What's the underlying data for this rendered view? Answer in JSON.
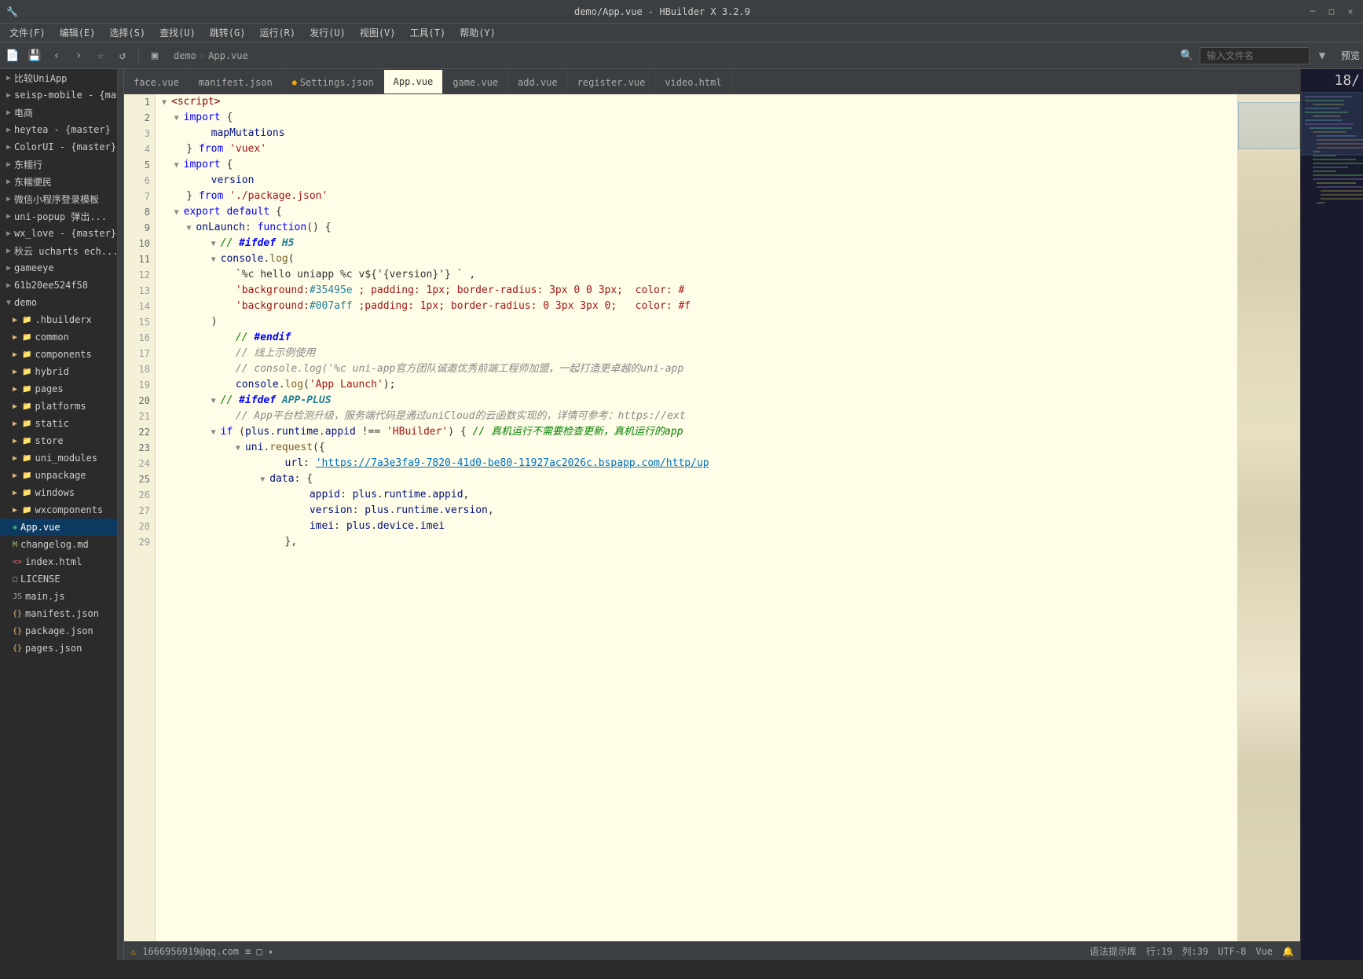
{
  "window": {
    "title": "demo/App.vue - HBuilder X 3.2.9"
  },
  "menubar": {
    "items": [
      "文件(F)",
      "编辑(E)",
      "选择(S)",
      "查找(U)",
      "跳转(G)",
      "运行(R)",
      "发行(U)",
      "视图(V)",
      "工具(T)",
      "帮助(Y)"
    ]
  },
  "toolbar": {
    "breadcrumb": [
      "demo",
      "App.vue"
    ],
    "search_placeholder": "输入文件名",
    "preview_label": "预览"
  },
  "tabs": [
    {
      "label": "face.vue",
      "active": false,
      "modified": false
    },
    {
      "label": "manifest.json",
      "active": false,
      "modified": false
    },
    {
      "label": "Settings.json",
      "active": false,
      "modified": true
    },
    {
      "label": "App.vue",
      "active": true,
      "modified": false
    },
    {
      "label": "game.vue",
      "active": false,
      "modified": false
    },
    {
      "label": "add.vue",
      "active": false,
      "modified": false
    },
    {
      "label": "register.vue",
      "active": false,
      "modified": false
    },
    {
      "label": "video.html",
      "active": false,
      "modified": false
    }
  ],
  "sidebar": {
    "items": [
      {
        "label": "比较UniApp",
        "type": "project",
        "indent": 0,
        "expanded": true
      },
      {
        "label": "seisp-mobile - {mas",
        "type": "project",
        "indent": 0,
        "expanded": false
      },
      {
        "label": "电商",
        "type": "project",
        "indent": 0,
        "expanded": false
      },
      {
        "label": "heytea - {master}",
        "type": "project",
        "indent": 0,
        "expanded": false
      },
      {
        "label": "ColorUI - {master}",
        "type": "project",
        "indent": 0,
        "expanded": false
      },
      {
        "label": "东糯行",
        "type": "project",
        "indent": 0,
        "expanded": false
      },
      {
        "label": "东糯便民",
        "type": "project",
        "indent": 0,
        "expanded": false
      },
      {
        "label": "微信小程序登录模板",
        "type": "project",
        "indent": 0,
        "expanded": false
      },
      {
        "label": "uni-popup 弹出...",
        "type": "project",
        "indent": 0,
        "expanded": false
      },
      {
        "label": "wx_love - {master}",
        "type": "project",
        "indent": 0,
        "expanded": false
      },
      {
        "label": "秋云 ucharts ech...",
        "type": "project",
        "indent": 0,
        "expanded": false
      },
      {
        "label": "gameeye",
        "type": "project",
        "indent": 0,
        "expanded": false
      },
      {
        "label": "61b20ee524f58",
        "type": "project",
        "indent": 0,
        "expanded": false
      },
      {
        "label": "demo",
        "type": "project",
        "indent": 0,
        "expanded": true
      },
      {
        "label": ".hbuilderx",
        "type": "folder",
        "indent": 1
      },
      {
        "label": "common",
        "type": "folder",
        "indent": 1
      },
      {
        "label": "components",
        "type": "folder",
        "indent": 1
      },
      {
        "label": "hybrid",
        "type": "folder",
        "indent": 1
      },
      {
        "label": "pages",
        "type": "folder",
        "indent": 1
      },
      {
        "label": "platforms",
        "type": "folder",
        "indent": 1
      },
      {
        "label": "static",
        "type": "folder",
        "indent": 1
      },
      {
        "label": "store",
        "type": "folder",
        "indent": 1
      },
      {
        "label": "uni_modules",
        "type": "folder",
        "indent": 1
      },
      {
        "label": "unpackage",
        "type": "folder",
        "indent": 1
      },
      {
        "label": "windows",
        "type": "folder",
        "indent": 1
      },
      {
        "label": "wxcomponents",
        "type": "folder",
        "indent": 1
      },
      {
        "label": "App.vue",
        "type": "vue",
        "indent": 1,
        "selected": true
      },
      {
        "label": "changelog.md",
        "type": "md",
        "indent": 1
      },
      {
        "label": "index.html",
        "type": "html",
        "indent": 1
      },
      {
        "label": "LICENSE",
        "type": "file",
        "indent": 1
      },
      {
        "label": "main.js",
        "type": "js",
        "indent": 1
      },
      {
        "label": "manifest.json",
        "type": "json",
        "indent": 1
      },
      {
        "label": "package.json",
        "type": "json",
        "indent": 1
      },
      {
        "label": "pages.json",
        "type": "json",
        "indent": 1
      }
    ]
  },
  "code": {
    "lines": [
      {
        "num": 1,
        "fold": true,
        "content": "<script>"
      },
      {
        "num": 2,
        "fold": true,
        "content": "    import {"
      },
      {
        "num": 3,
        "fold": false,
        "content": "        mapMutations"
      },
      {
        "num": 4,
        "fold": false,
        "content": "    } from 'vuex'"
      },
      {
        "num": 5,
        "fold": true,
        "content": "    import {"
      },
      {
        "num": 6,
        "fold": false,
        "content": "        version"
      },
      {
        "num": 7,
        "fold": false,
        "content": "    } from './package.json'"
      },
      {
        "num": 8,
        "fold": true,
        "content": "    export default {"
      },
      {
        "num": 9,
        "fold": true,
        "content": "        onLaunch: function() {"
      },
      {
        "num": 10,
        "fold": true,
        "content": "            // #ifdef H5"
      },
      {
        "num": 11,
        "fold": true,
        "content": "            console.log("
      },
      {
        "num": 12,
        "fold": false,
        "content": "                `%c hello uniapp %c v${version}` ,"
      },
      {
        "num": 13,
        "fold": false,
        "content": "                'background:#35495e ; padding: 1px; border-radius: 3px 0 0 3px;  color: #"
      },
      {
        "num": 14,
        "fold": false,
        "content": "                'background:#007aff ;padding: 1px; border-radius: 0 3px 3px 0;   color: #f"
      },
      {
        "num": 15,
        "fold": false,
        "content": "            )"
      },
      {
        "num": 16,
        "fold": false,
        "content": "            // #endif"
      },
      {
        "num": 17,
        "fold": false,
        "content": "            // 线上示例使用"
      },
      {
        "num": 18,
        "fold": false,
        "content": "            // console.log('%c uni-app官方团队诚邀优秀前端工程师加盟，一起打造更卓越的uni-app"
      },
      {
        "num": 19,
        "fold": false,
        "content": "            console.log('App Launch');"
      },
      {
        "num": 20,
        "fold": true,
        "content": "            // #ifdef APP-PLUS"
      },
      {
        "num": 21,
        "fold": false,
        "content": "            // App平台检测升级，服务端代码是通过uniCloud的云函数实现的，详情可参考：https://ext"
      },
      {
        "num": 22,
        "fold": true,
        "content": "            if (plus.runtime.appid !== 'HBuilder') { // 真机运行不需要检查更新，真机运行的app"
      },
      {
        "num": 23,
        "fold": true,
        "content": "                uni.request({"
      },
      {
        "num": 24,
        "fold": false,
        "content": "                    url: 'https://7a3e3fa9-7820-41d0-be80-11927ac2026c.bspapp.com/http/up"
      },
      {
        "num": 25,
        "fold": true,
        "content": "                    data: {"
      },
      {
        "num": 26,
        "fold": false,
        "content": "                        appid: plus.runtime.appid,"
      },
      {
        "num": 27,
        "fold": false,
        "content": "                        version: plus.runtime.version,"
      },
      {
        "num": 28,
        "fold": false,
        "content": "                        imei: plus.device.imei"
      },
      {
        "num": 29,
        "fold": false,
        "content": "                    },"
      }
    ]
  },
  "statusbar": {
    "email": "1666956919@qq.com",
    "hint": "语法提示库",
    "line": "行:19",
    "col": "列:39",
    "encoding": "UTF-8",
    "language": "Vue"
  },
  "right_panel": {
    "number": "18/"
  }
}
